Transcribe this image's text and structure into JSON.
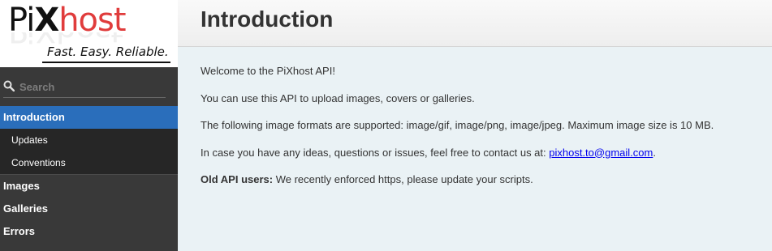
{
  "logo": {
    "brand_pi": "Pi",
    "brand_x": "X",
    "brand_host": "host",
    "tagline": "Fast. Easy. Reliable."
  },
  "search": {
    "placeholder": "Search",
    "value": ""
  },
  "sidebar": {
    "items": [
      {
        "label": "Introduction",
        "active": true,
        "children": [
          {
            "label": "Updates"
          },
          {
            "label": "Conventions"
          }
        ]
      },
      {
        "label": "Images"
      },
      {
        "label": "Galleries"
      },
      {
        "label": "Errors"
      }
    ]
  },
  "header": {
    "title": "Introduction"
  },
  "main": {
    "welcome": "Welcome to the PiXhost API!",
    "usage": "You can use this API to upload images, covers or galleries.",
    "formats": "The following image formats are supported: image/gif, image/png, image/jpeg. Maximum image size is 10 MB.",
    "contact_prefix": "In case you have any ideas, questions or issues, feel free to contact us at: ",
    "contact_email": "pixhost.to@gmail.com",
    "contact_suffix": ".",
    "old_api_label": "Old API users:",
    "old_api_text": " We recently enforced https, please update your scripts."
  },
  "colors": {
    "sidebar_bg": "#393939",
    "active_bg": "#2a6ebb",
    "content_bg": "#eaf2f5",
    "brand_red": "#e03c3c"
  }
}
